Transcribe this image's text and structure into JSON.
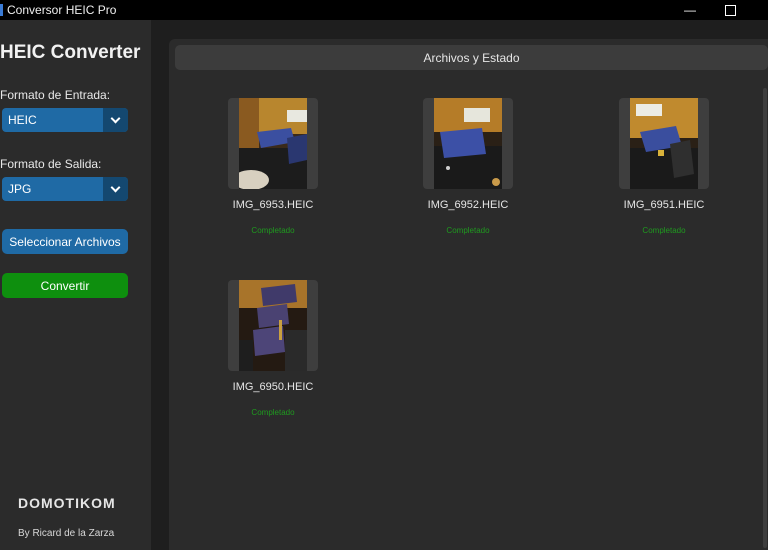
{
  "window": {
    "title": "Conversor HEIC Pro",
    "minimize_glyph": "—"
  },
  "sidebar": {
    "title": "HEIC Converter",
    "input_format_label": "Formato de Entrada:",
    "input_format_value": "HEIC",
    "output_format_label": "Formato de Salida:",
    "output_format_value": "JPG",
    "select_files_label": "Seleccionar Archivos",
    "convert_label": "Convertir",
    "footer_brand": "DOMOTIKOM",
    "footer_author": "By Ricard de la Zarza"
  },
  "main": {
    "header": "Archivos y Estado",
    "files": [
      {
        "name": "IMG_6953.HEIC",
        "status": "Completado"
      },
      {
        "name": "IMG_6952.HEIC",
        "status": "Completado"
      },
      {
        "name": "IMG_6951.HEIC",
        "status": "Completado"
      },
      {
        "name": "IMG_6950.HEIC",
        "status": "Completado"
      }
    ]
  },
  "colors": {
    "accent_blue": "#1f6aa5",
    "convert_green": "#0e8f0e",
    "status_green": "#1f9a1f",
    "panel_bg": "#2b2b2b",
    "app_bg": "#1e1e1e"
  }
}
